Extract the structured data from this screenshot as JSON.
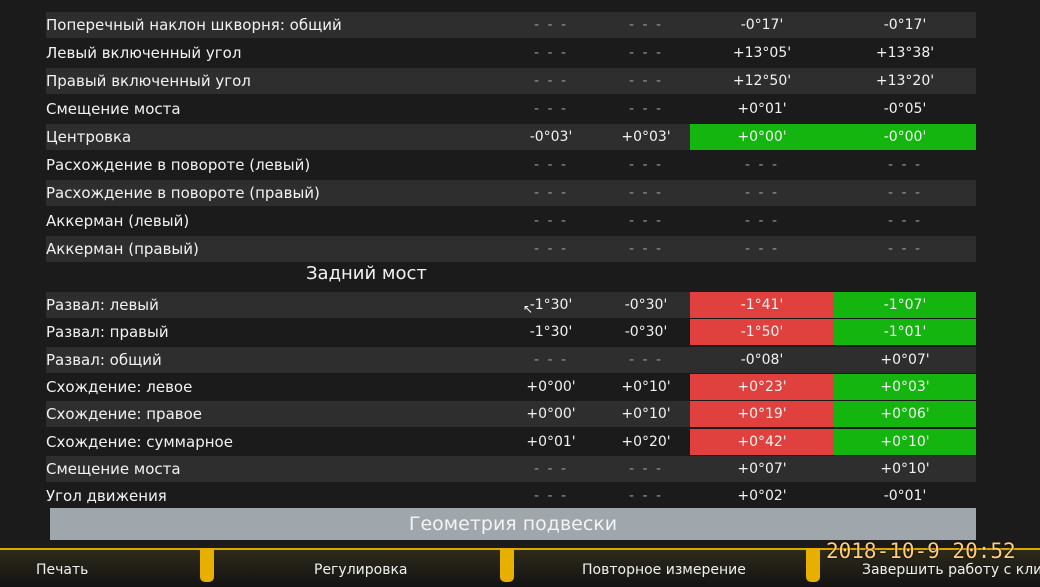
{
  "front_rows": [
    {
      "label": "Поперечный наклон шкворня: общий",
      "v1": "- - -",
      "v2": "- - -",
      "v3": "-0°17'",
      "v4": "-0°17'",
      "s3": "",
      "s4": ""
    },
    {
      "label": "Левый включенный угол",
      "v1": "- - -",
      "v2": "- - -",
      "v3": "+13°05'",
      "v4": "+13°38'",
      "s3": "",
      "s4": ""
    },
    {
      "label": "Правый включенный угол",
      "v1": "- - -",
      "v2": "- - -",
      "v3": "+12°50'",
      "v4": "+13°20'",
      "s3": "",
      "s4": ""
    },
    {
      "label": "Смещение моста",
      "v1": "- - -",
      "v2": "- - -",
      "v3": "+0°01'",
      "v4": "-0°05'",
      "s3": "",
      "s4": ""
    },
    {
      "label": "Центровка",
      "v1": "-0°03'",
      "v2": "+0°03'",
      "v3": "+0°00'",
      "v4": "-0°00'",
      "s3": "green",
      "s4": "green"
    },
    {
      "label": "Расхождение в повороте (левый)",
      "v1": "- - -",
      "v2": "- - -",
      "v3": "- - -",
      "v4": "- - -",
      "s3": "",
      "s4": ""
    },
    {
      "label": "Расхождение в повороте (правый)",
      "v1": "- - -",
      "v2": "- - -",
      "v3": "- - -",
      "v4": "- - -",
      "s3": "",
      "s4": ""
    },
    {
      "label": "Аккерман (левый)",
      "v1": "- - -",
      "v2": "- - -",
      "v3": "- - -",
      "v4": "- - -",
      "s3": "",
      "s4": ""
    },
    {
      "label": "Аккерман (правый)",
      "v1": "- - -",
      "v2": "- - -",
      "v3": "- - -",
      "v4": "- - -",
      "s3": "",
      "s4": ""
    }
  ],
  "rear_title": "Задний мост",
  "rear_rows": [
    {
      "label": "Развал: левый",
      "v1": "-1°30'",
      "v2": "-0°30'",
      "v3": "-1°41'",
      "v4": "-1°07'",
      "s3": "red",
      "s4": "green"
    },
    {
      "label": "Развал: правый",
      "v1": "-1°30'",
      "v2": "-0°30'",
      "v3": "-1°50'",
      "v4": "-1°01'",
      "s3": "red",
      "s4": "green"
    },
    {
      "label": "Развал: общий",
      "v1": "- - -",
      "v2": "- - -",
      "v3": "-0°08'",
      "v4": "+0°07'",
      "s3": "",
      "s4": ""
    },
    {
      "label": "Схождение: левое",
      "v1": "+0°00'",
      "v2": "+0°10'",
      "v3": "+0°23'",
      "v4": "+0°03'",
      "s3": "red",
      "s4": "green"
    },
    {
      "label": "Схождение: правое",
      "v1": "+0°00'",
      "v2": "+0°10'",
      "v3": "+0°19'",
      "v4": "+0°06'",
      "s3": "red",
      "s4": "green"
    },
    {
      "label": "Схождение: суммарное",
      "v1": "+0°01'",
      "v2": "+0°20'",
      "v3": "+0°42'",
      "v4": "+0°10'",
      "s3": "red",
      "s4": "green"
    },
    {
      "label": "Смещение моста",
      "v1": "- - -",
      "v2": "- - -",
      "v3": "+0°07'",
      "v4": "+0°10'",
      "s3": "",
      "s4": ""
    },
    {
      "label": "Угол движения",
      "v1": "- - -",
      "v2": "- - -",
      "v3": "+0°02'",
      "v4": "-0°01'",
      "s3": "",
      "s4": ""
    }
  ],
  "geometry_bar": "Геометрия подвески",
  "bottom_buttons": {
    "print": "Печать",
    "adjust": "Регулировка",
    "remeasure": "Повторное измерение",
    "finish": "Завершить работу с клиен"
  },
  "timestamp": "2018-10-9 20:52",
  "colors": {
    "green": "#15b50f",
    "red": "#e0413f",
    "accent": "#e7b000"
  }
}
